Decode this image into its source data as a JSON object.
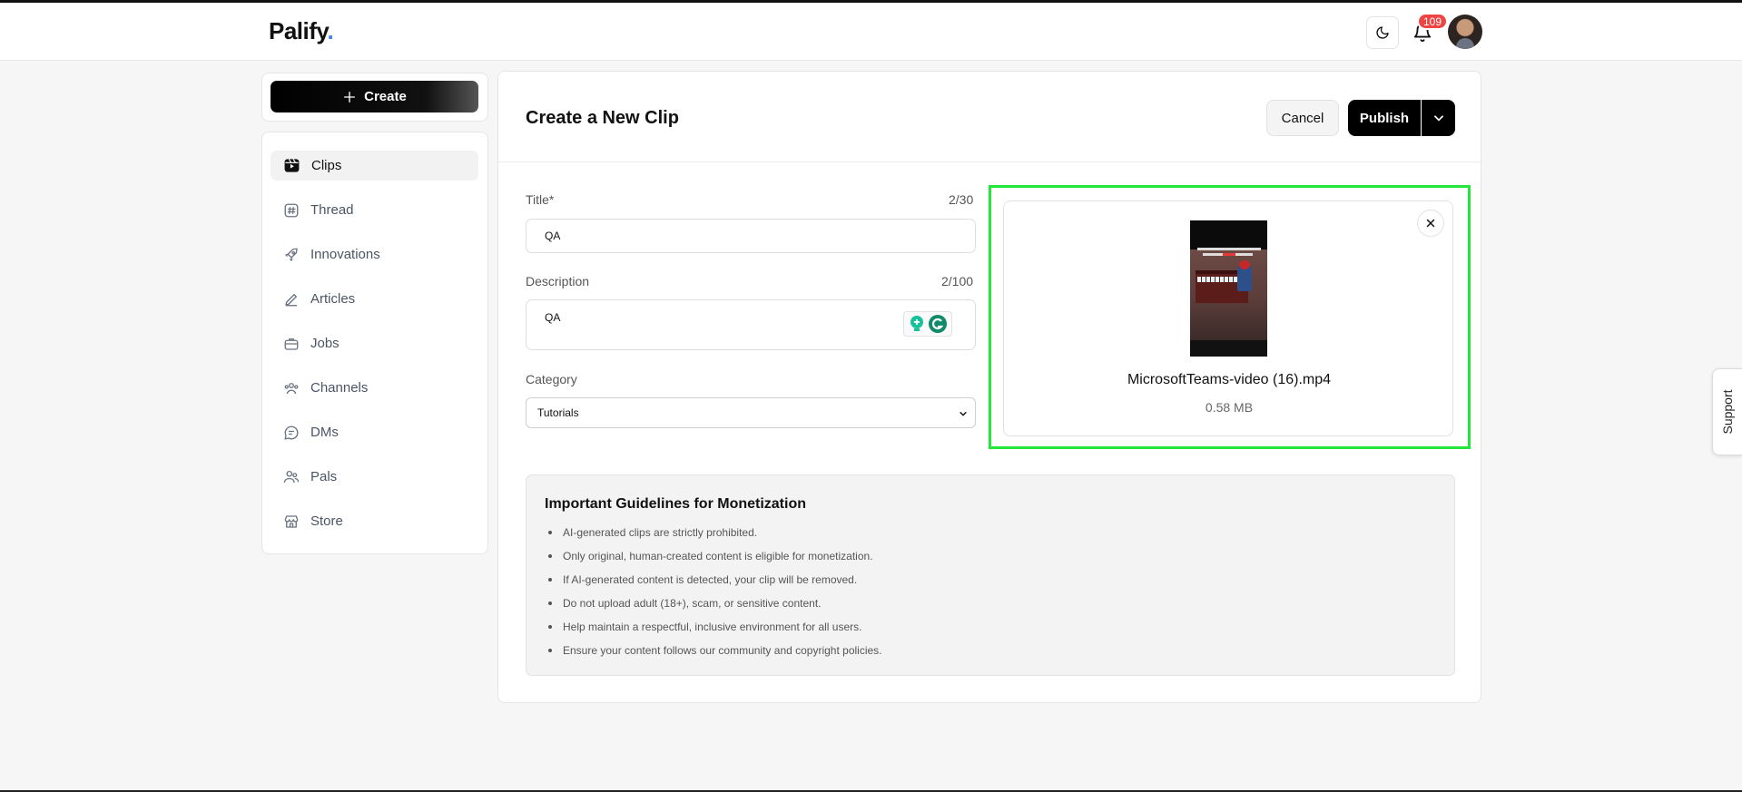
{
  "header": {
    "logo_text": "Palify",
    "logo_dot": ".",
    "notification_count": "109"
  },
  "sidebar": {
    "create_label": "Create",
    "items": [
      {
        "label": "Clips",
        "icon": "clips-icon",
        "active": true
      },
      {
        "label": "Thread",
        "icon": "hash-icon"
      },
      {
        "label": "Innovations",
        "icon": "rocket-icon"
      },
      {
        "label": "Articles",
        "icon": "pencil-icon"
      },
      {
        "label": "Jobs",
        "icon": "briefcase-icon"
      },
      {
        "label": "Channels",
        "icon": "users-icon"
      },
      {
        "label": "DMs",
        "icon": "chat-icon"
      },
      {
        "label": "Pals",
        "icon": "pals-icon"
      },
      {
        "label": "Store",
        "icon": "store-icon"
      }
    ]
  },
  "main": {
    "title": "Create a New Clip",
    "cancel_label": "Cancel",
    "publish_label": "Publish",
    "title_field": {
      "label": "Title*",
      "count": "2/30",
      "value": "QA"
    },
    "description_field": {
      "label": "Description",
      "count": "2/100",
      "value": "QA"
    },
    "category_field": {
      "label": "Category",
      "value": "Tutorials"
    }
  },
  "preview": {
    "file_name": "MicrosoftTeams-video (16).mp4",
    "file_size": "0.58 MB",
    "highlight_color": "#22e83a"
  },
  "guidelines": {
    "title": "Important Guidelines for Monetization",
    "items": [
      "AI-generated clips are strictly prohibited.",
      "Only original, human-created content is eligible for monetization.",
      "If AI-generated content is detected, your clip will be removed.",
      "Do not upload adult (18+), scam, or sensitive content.",
      "Help maintain a respectful, inclusive environment for all users.",
      "Ensure your content follows our community and copyright policies."
    ]
  },
  "support": {
    "label": "Support"
  }
}
